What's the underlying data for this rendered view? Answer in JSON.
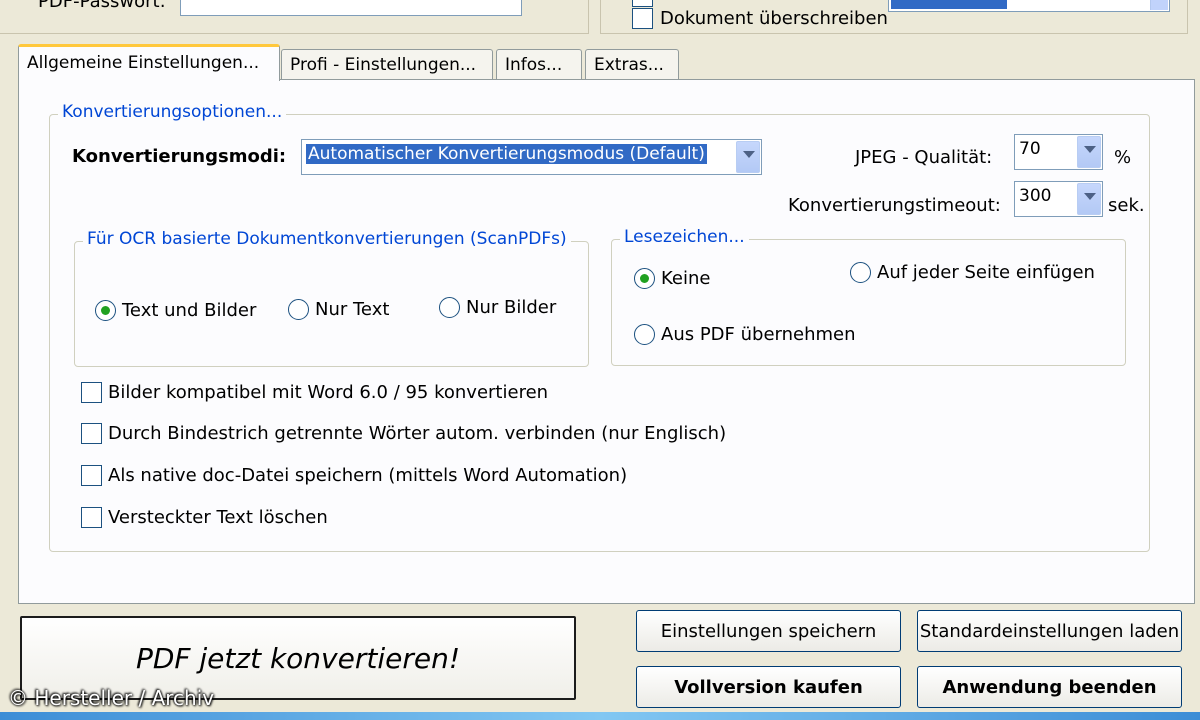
{
  "top": {
    "password_label": "PDF-Passwort:",
    "password_value": "",
    "overwrite_label": "Dokument überschreiben",
    "overwrite_checked": false
  },
  "tabs": [
    {
      "label": "Allgemeine Einstellungen...",
      "active": true
    },
    {
      "label": "Profi - Einstellungen...",
      "active": false
    },
    {
      "label": "Infos...",
      "active": false
    },
    {
      "label": "Extras...",
      "active": false
    }
  ],
  "conversion": {
    "group_title": "Konvertierungsoptionen...",
    "mode_label": "Konvertierungsmodi:",
    "mode_value": "Automatischer Konvertierungsmodus (Default)",
    "jpeg_label": "JPEG - Qualität:",
    "jpeg_value": "70",
    "jpeg_unit": "%",
    "timeout_label": "Konvertierungstimeout:",
    "timeout_value": "300",
    "timeout_unit": "sek."
  },
  "ocr": {
    "group_title": "Für OCR basierte Dokumentkonvertierungen (ScanPDFs)",
    "options": [
      {
        "label": "Text und Bilder",
        "selected": true
      },
      {
        "label": "Nur Text",
        "selected": false
      },
      {
        "label": "Nur Bilder",
        "selected": false
      }
    ]
  },
  "bookmarks": {
    "group_title": "Lesezeichen...",
    "options": [
      {
        "label": "Keine",
        "selected": true
      },
      {
        "label": "Auf jeder Seite einfügen",
        "selected": false
      },
      {
        "label": "Aus PDF übernehmen",
        "selected": false
      }
    ]
  },
  "checkboxes": [
    {
      "label": "Bilder kompatibel mit Word 6.0 / 95 konvertieren",
      "checked": false
    },
    {
      "label": "Durch Bindestrich getrennte Wörter autom. verbinden (nur Englisch)",
      "checked": false
    },
    {
      "label": "Als native doc-Datei speichern (mittels Word Automation)",
      "checked": false
    },
    {
      "label": "Versteckter Text löschen",
      "checked": false
    }
  ],
  "buttons": {
    "convert": "PDF jetzt konvertieren!",
    "save_settings": "Einstellungen speichern",
    "load_defaults": "Standardeinstellungen laden",
    "buy_full": "Vollversion kaufen",
    "quit": "Anwendung beenden"
  },
  "copyright": "© Hersteller / Archiv",
  "colors": {
    "window_bg": "#ece9d8",
    "panel_bg": "#fcfcfe",
    "group_title": "#0046d5",
    "selection": "#316ac5",
    "active_tab_accent": "#ffc83c",
    "radio_dot": "#21a121"
  }
}
